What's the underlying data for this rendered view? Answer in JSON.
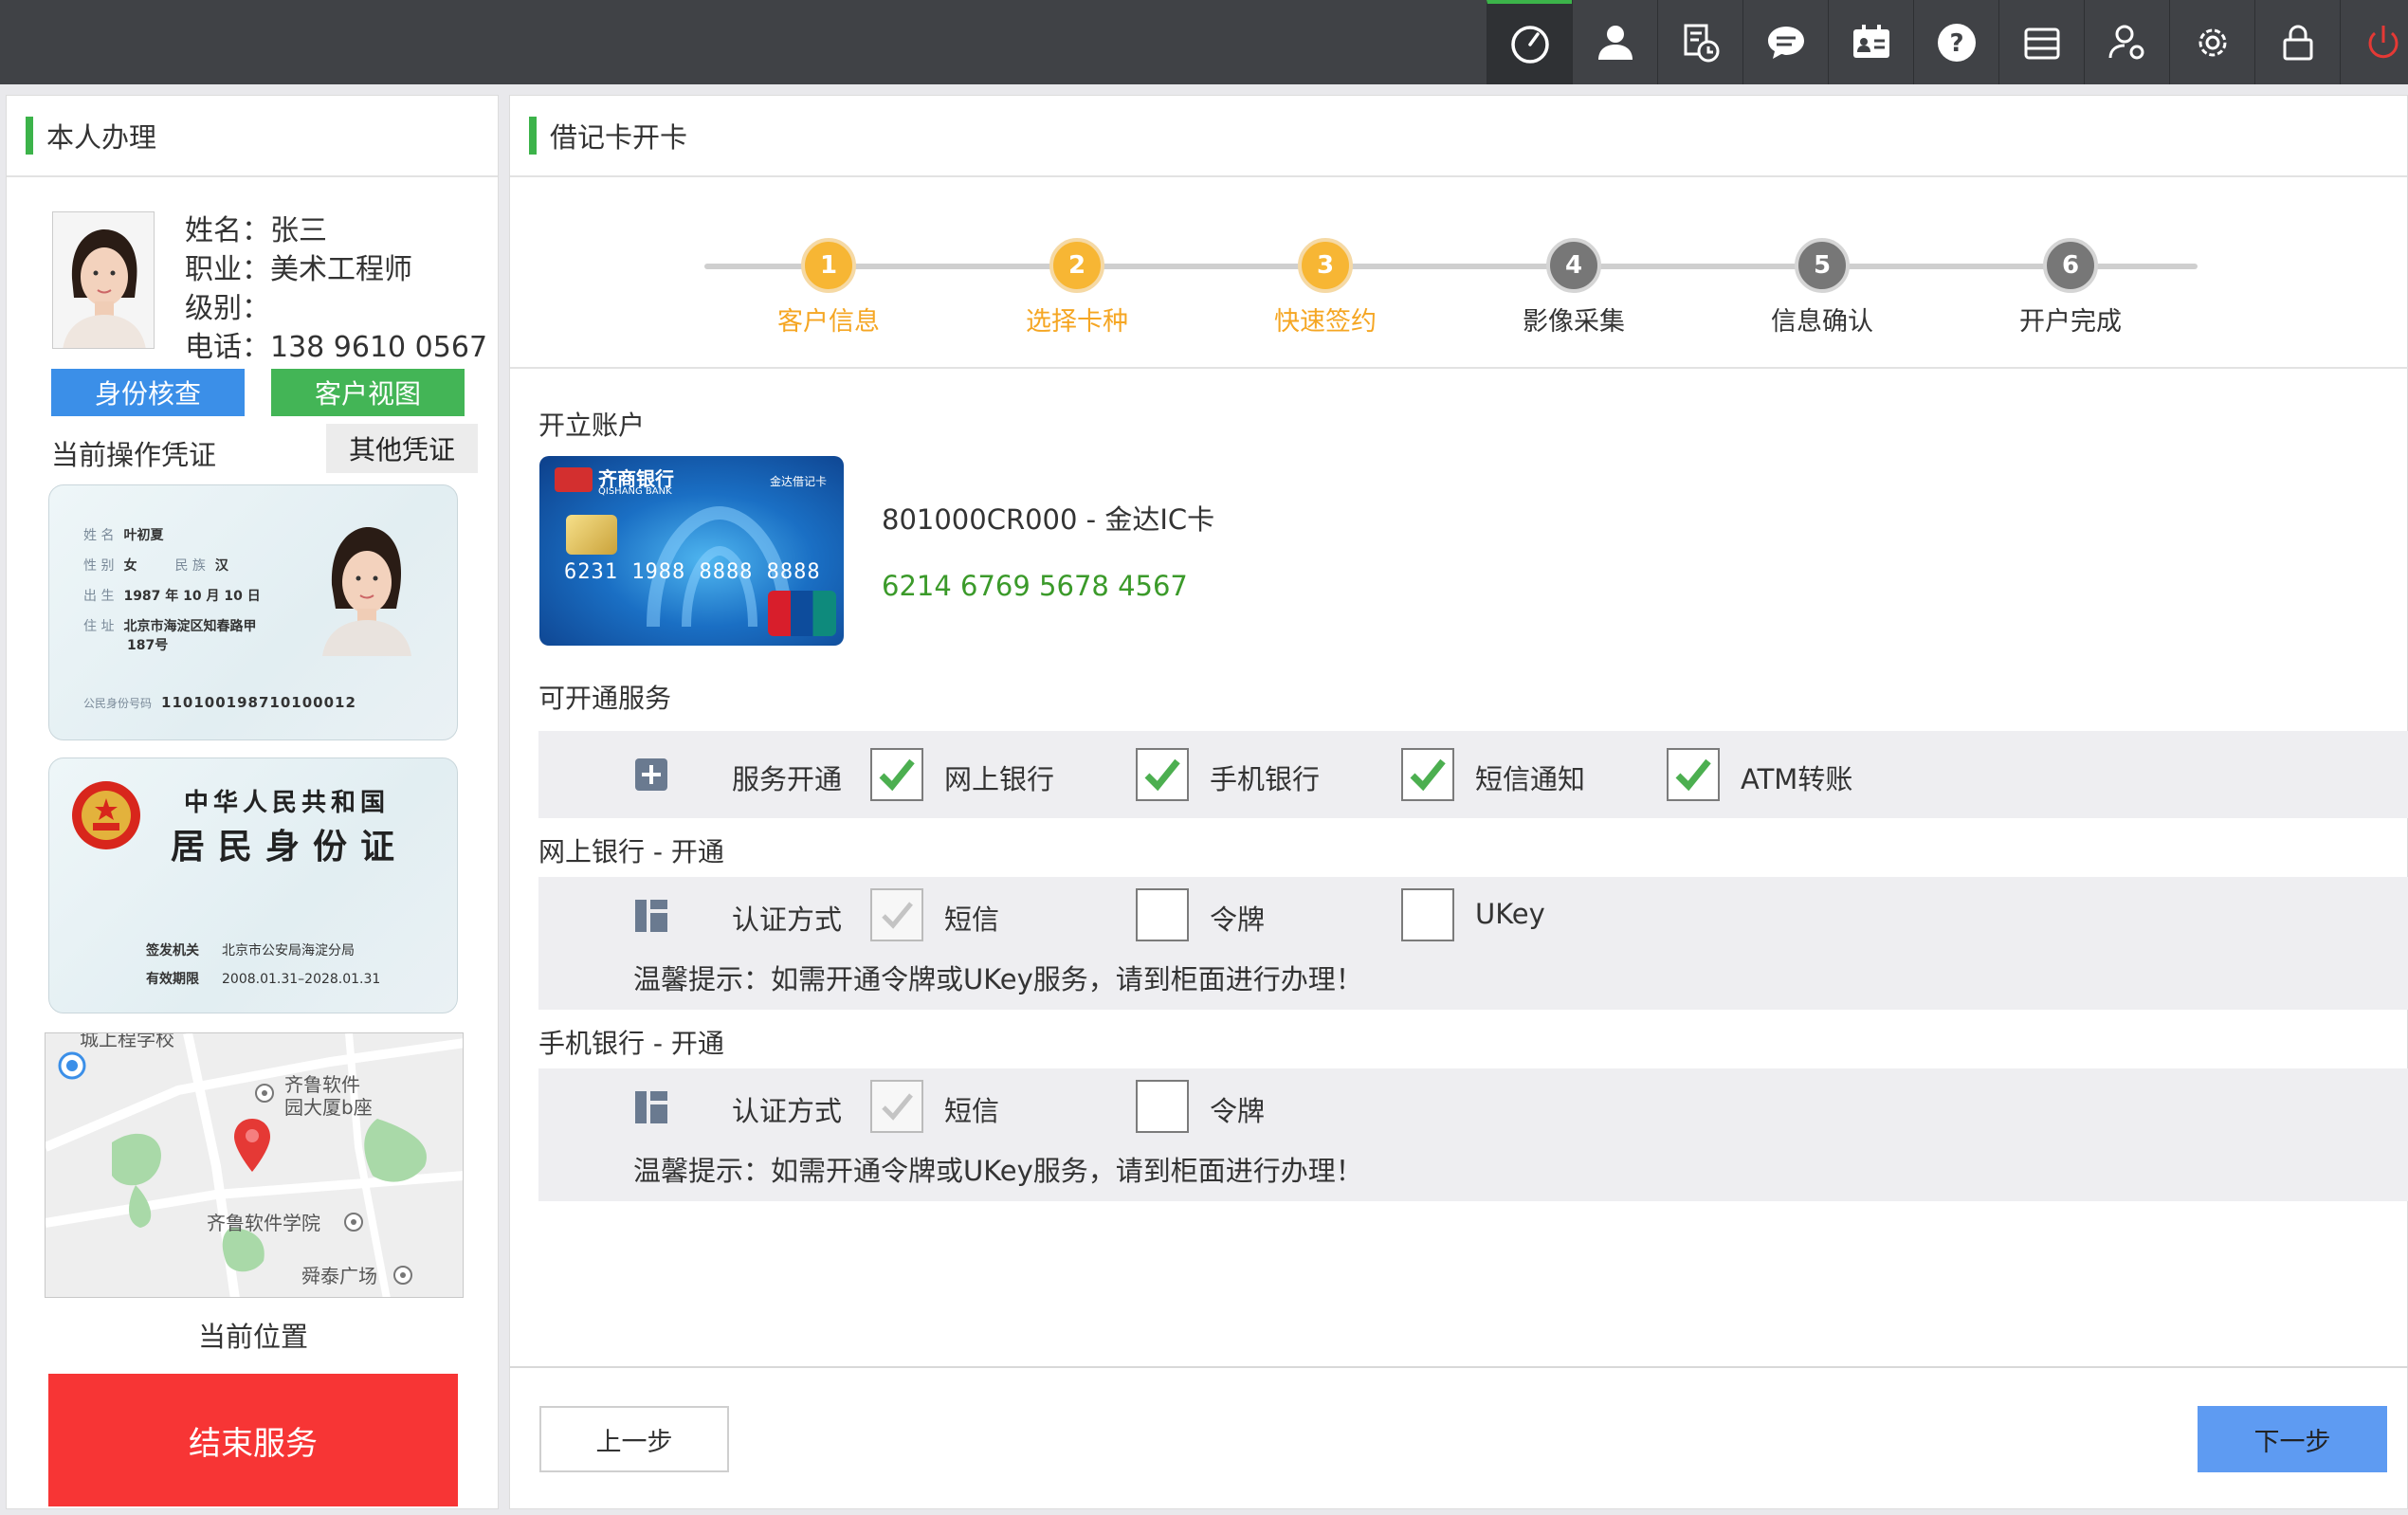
{
  "topbar": {
    "icons": [
      "dashboard-icon",
      "user-icon",
      "history-icon",
      "message-icon",
      "id-card-icon",
      "help-icon",
      "server-icon",
      "user-settings-icon",
      "gear-icon",
      "lock-icon",
      "power-icon"
    ],
    "accent": "#3cb34a",
    "power_color": "#e53935"
  },
  "left": {
    "title": "本人办理",
    "customer": {
      "name": "姓名：张三",
      "job": "职业：美术工程师",
      "level": "级别：",
      "phone": "电话：138 9610 0567"
    },
    "btn_id_check": "身份核查",
    "btn_customer_view": "客户视图",
    "current_credential": "当前操作凭证",
    "other_credential": "其他凭证",
    "id_front": {
      "name_label": "姓 名",
      "name": "叶初夏",
      "sex_label": "性 别",
      "sex": "女",
      "nation_label": "民 族",
      "nation": "汉",
      "birth_label": "出 生",
      "birth": "1987  年 10 月 10 日",
      "addr_label": "住 址",
      "addr1": "北京市海淀区知春路甲",
      "addr2": "187号",
      "idno_label": "公民身份号码",
      "idno": "110100198710100012"
    },
    "id_back": {
      "country": "中华人民共和国",
      "title": "居民身份证",
      "authority_label": "签发机关",
      "authority": "北京市公安局海淀分局",
      "valid_label": "有效期限",
      "valid": "2008.01.31–2028.01.31"
    },
    "map": {
      "poi1_line1": "齐鲁软件",
      "poi1_line2": "园大厦b座",
      "poi2": "齐鲁软件学院",
      "poi3": "舜泰广场",
      "poi_top": "城上程学校"
    },
    "current_position": "当前位置",
    "end_service": "结束服务"
  },
  "right": {
    "title": "借记卡开卡",
    "steps": [
      {
        "num": "1",
        "label": "客户信息",
        "done": true
      },
      {
        "num": "2",
        "label": "选择卡种",
        "done": true
      },
      {
        "num": "3",
        "label": "快速签约",
        "done": true
      },
      {
        "num": "4",
        "label": "影像采集",
        "done": false
      },
      {
        "num": "5",
        "label": "信息确认",
        "done": false
      },
      {
        "num": "6",
        "label": "开户完成",
        "done": false
      }
    ],
    "open_account": "开立账户",
    "card": {
      "bank_name": "齐商银行",
      "bank_en": "QISHANG BANK",
      "card_type": "金达借记卡",
      "embossed_no": "6231 1988 8888 8888",
      "code": "801000CR000 - 金达IC卡",
      "number": "6214 6769 5678 4567"
    },
    "services_title": "可开通服务",
    "services_label": "服务开通",
    "services": [
      "网上银行",
      "手机银行",
      "短信通知",
      "ATM转账"
    ],
    "ebank_title": "网上银行 - 开通",
    "ebank_auth_label": "认证方式",
    "ebank_auth": [
      "短信",
      "令牌",
      "UKey"
    ],
    "ebank_tip": "温馨提示：如需开通令牌或UKey服务，请到柜面进行办理！",
    "mbank_title": "手机银行 - 开通",
    "mbank_auth_label": "认证方式",
    "mbank_auth": [
      "短信",
      "令牌"
    ],
    "mbank_tip": "温馨提示：如需开通令牌或UKey服务，请到柜面进行办理！",
    "btn_prev": "上一步",
    "btn_next": "下一步"
  }
}
